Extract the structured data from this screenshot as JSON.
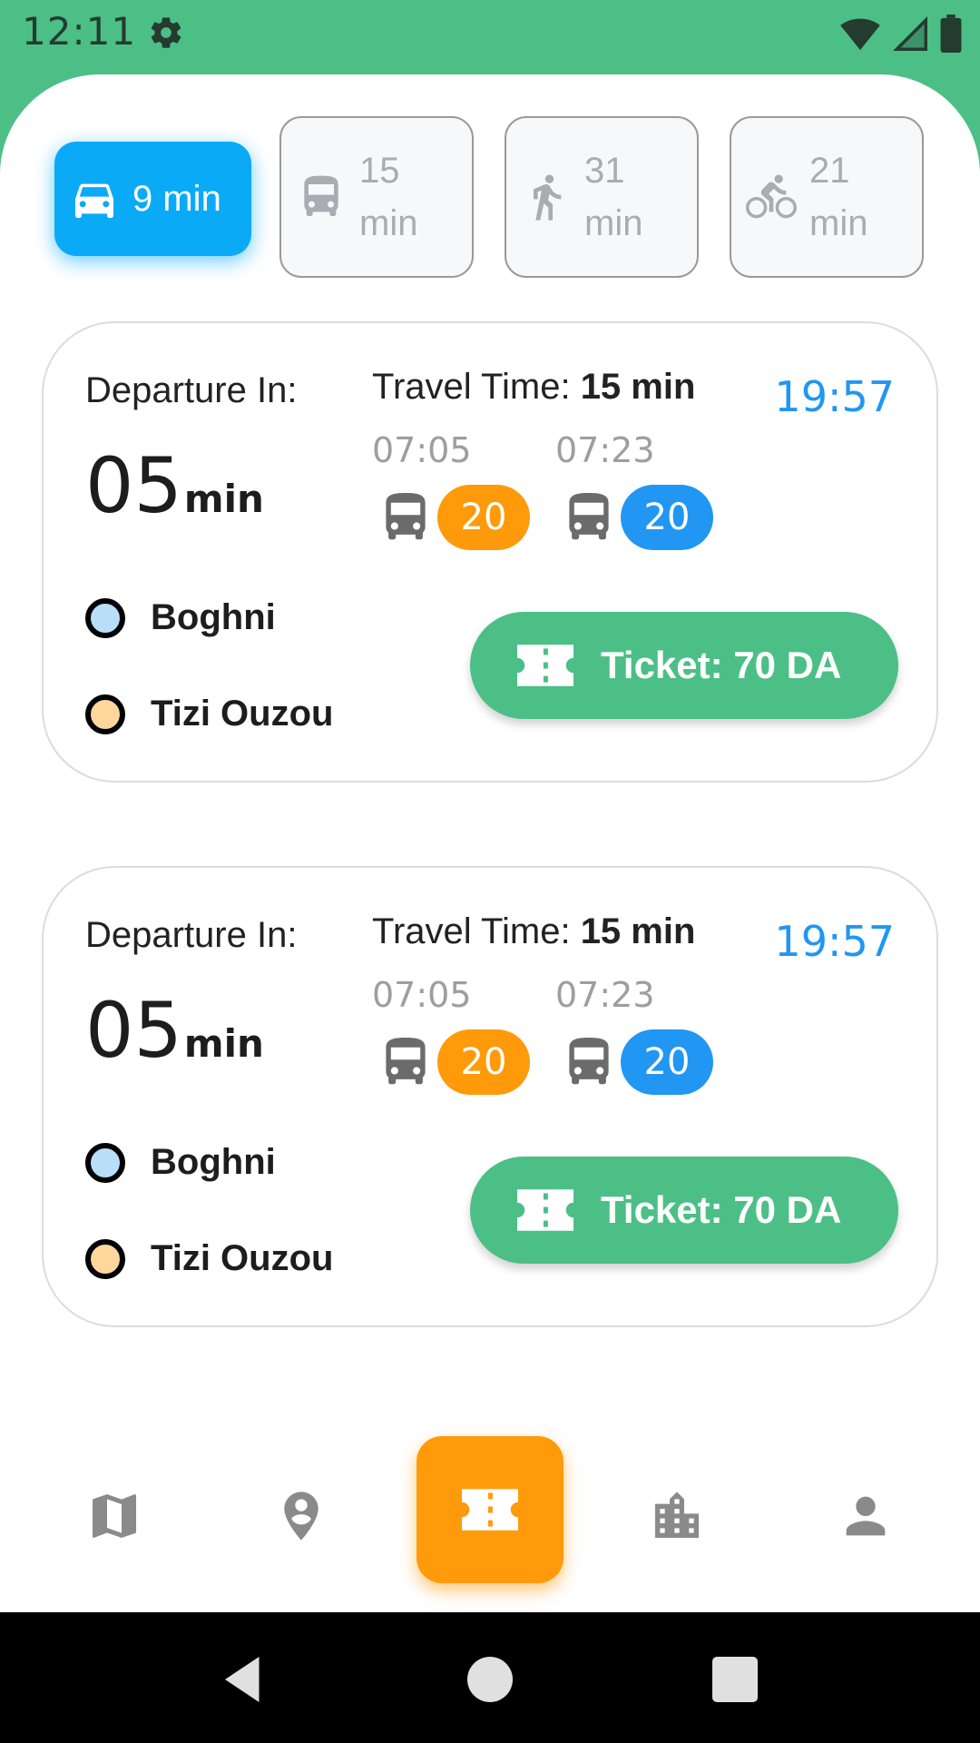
{
  "status_bar": {
    "time": "12:11",
    "icons": [
      "gear-icon",
      "wifi-icon",
      "signal-icon",
      "battery-icon"
    ]
  },
  "modes": [
    {
      "icon": "car-icon",
      "label": "9 min",
      "active": true
    },
    {
      "icon": "bus-icon",
      "label": "15 min",
      "active": false
    },
    {
      "icon": "walk-icon",
      "label": "31 min",
      "active": false
    },
    {
      "icon": "bike-icon",
      "label": "21 min",
      "active": false
    }
  ],
  "cards": [
    {
      "departure_label": "Departure In:",
      "departure_value": "05",
      "departure_unit": "min",
      "travel_label": "Travel Time:",
      "travel_value": "15 min",
      "clock": "19:57",
      "legs": [
        {
          "time": "07:05",
          "line": "20",
          "color": "#ff9a0a"
        },
        {
          "time": "07:23",
          "line": "20",
          "color": "#2196f3"
        }
      ],
      "from": "Boghni",
      "to": "Tizi Ouzou",
      "ticket_label": "Ticket: 70 DA"
    },
    {
      "departure_label": "Departure In:",
      "departure_value": "05",
      "departure_unit": "min",
      "travel_label": "Travel Time:",
      "travel_value": "15 min",
      "clock": "19:57",
      "legs": [
        {
          "time": "07:05",
          "line": "20",
          "color": "#ff9a0a"
        },
        {
          "time": "07:23",
          "line": "20",
          "color": "#2196f3"
        }
      ],
      "from": "Boghni",
      "to": "Tizi Ouzou",
      "ticket_label": "Ticket: 70 DA"
    }
  ],
  "bottom_nav": {
    "items": [
      "map-icon",
      "location-pin-icon",
      "ticket-icon",
      "buildings-icon",
      "person-icon"
    ],
    "active": "ticket-icon"
  },
  "colors": {
    "brand_green": "#4cbf87",
    "active_mode_blue": "#0aaaf6",
    "accent_orange": "#ff9a0a",
    "accent_blue": "#2196f3"
  }
}
